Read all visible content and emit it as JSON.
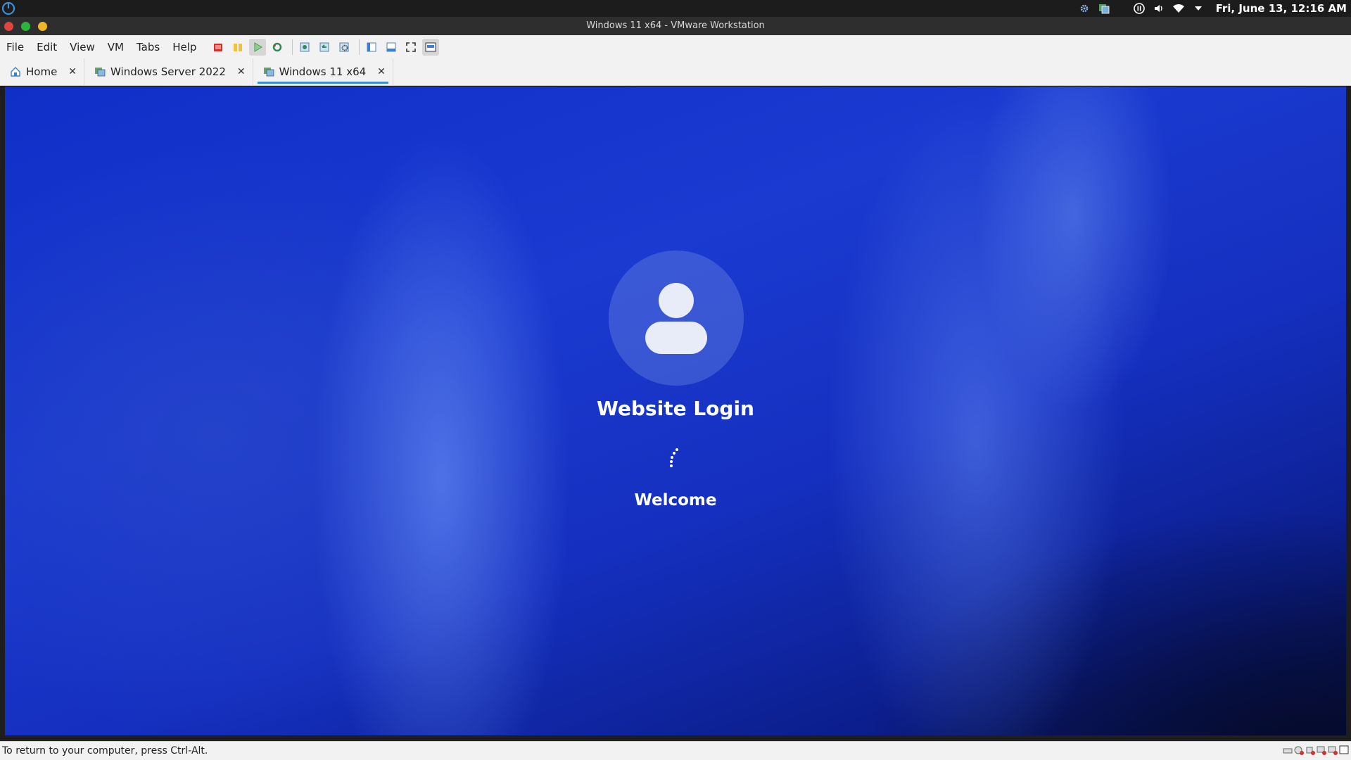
{
  "system_panel": {
    "clock": "Fri, June 13, 12:16 AM",
    "tray_icons": [
      "settings-icon",
      "vmware-tray-icon",
      "pause-icon",
      "volume-icon",
      "wifi-icon",
      "dropdown-arrow-icon"
    ]
  },
  "window": {
    "title": "Windows 11 x64 - VMware Workstation",
    "controls": {
      "close_color": "#e0443e",
      "maximize_color": "#2bb33c",
      "minimize_color": "#f0b429"
    }
  },
  "menu": {
    "items": [
      "File",
      "Edit",
      "View",
      "VM",
      "Tabs",
      "Help"
    ]
  },
  "toolbar": {
    "buttons": [
      "power-off-icon",
      "suspend-icon",
      "play-icon",
      "reset-icon",
      "snapshot-icon",
      "revert-snapshot-icon",
      "snapshot-manager-icon",
      "library-icon",
      "thumbnail-bar-icon",
      "fullscreen-icon",
      "unity-icon"
    ]
  },
  "tabs": [
    {
      "label": "Home",
      "icon": "home-icon",
      "active": false
    },
    {
      "label": "Windows Server 2022",
      "icon": "vm-icon",
      "active": false
    },
    {
      "label": "Windows 11 x64",
      "icon": "vm-icon",
      "active": true
    }
  ],
  "vm_screen": {
    "title": "Website Login",
    "status": "Welcome",
    "accent": "#1a3ad0"
  },
  "statusbar": {
    "message": "To return to your computer, press Ctrl-Alt.",
    "device_icons": [
      "hard-disk-icon",
      "cd-icon",
      "network-icon",
      "usb-icon",
      "sound-icon",
      "display-icon"
    ]
  }
}
